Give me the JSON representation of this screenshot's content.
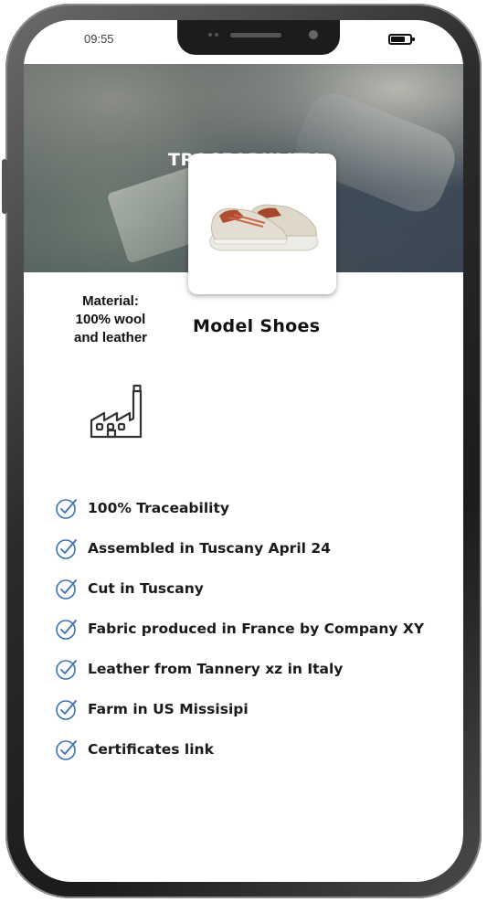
{
  "status_bar": {
    "time": "09:55"
  },
  "icons": {
    "battery": "battery-icon",
    "factory": "factory-icon",
    "check": "check-circle-icon",
    "product": "sneaker-image"
  },
  "colors": {
    "check_icon": "#3d6fb5",
    "text": "#1a1a1a",
    "hero_title": "#ffffff"
  },
  "header": {
    "title": "TRACEABIILITY"
  },
  "product": {
    "material_line1": "Material:",
    "material_line2": "100% wool",
    "material_line3": "and leather",
    "name": "Model Shoes"
  },
  "traceability_items": [
    "100% Traceability",
    "Assembled in Tuscany April 24",
    "Cut in Tuscany",
    "Fabric produced in France by Company XY",
    "Leather from Tannery xz in Italy",
    "Farm in US Missisipi",
    "Certificates link"
  ]
}
